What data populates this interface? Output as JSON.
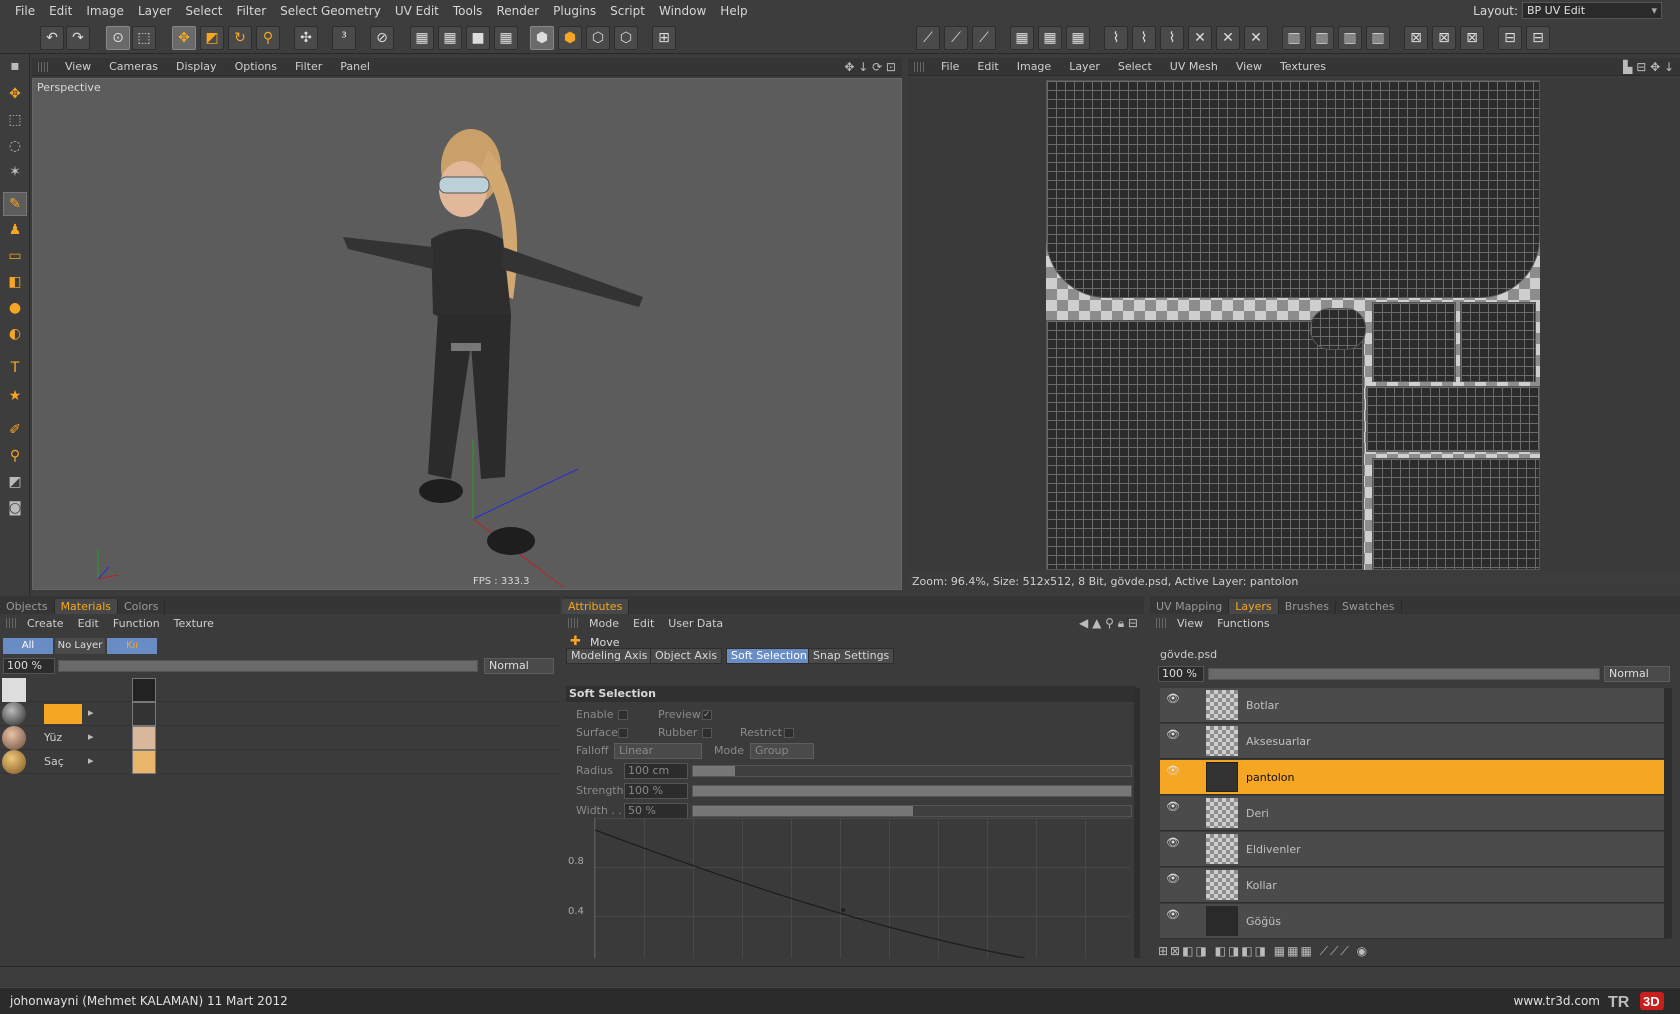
{
  "menu": [
    "File",
    "Edit",
    "Image",
    "Layer",
    "Select",
    "Filter",
    "Select Geometry",
    "UV Edit",
    "Tools",
    "Render",
    "Plugins",
    "Script",
    "Window",
    "Help"
  ],
  "layout": {
    "label": "Layout:",
    "value": "BP UV Edit"
  },
  "viewport3d": {
    "menu": [
      "View",
      "Cameras",
      "Display",
      "Options",
      "Filter",
      "Panel"
    ],
    "name": "Perspective",
    "fps": "FPS : 333.3"
  },
  "uvpanel": {
    "menu": [
      "File",
      "Edit",
      "Image",
      "Layer",
      "Select",
      "UV Mesh",
      "View",
      "Textures"
    ],
    "status": "Zoom: 96.4%, Size: 512x512, 8 Bit, gövde.psd, Active Layer: pantolon"
  },
  "leftpanel": {
    "tabs": [
      "Objects",
      "Materials",
      "Colors"
    ],
    "menu": [
      "Create",
      "Edit",
      "Function",
      "Texture"
    ],
    "filters": [
      "All",
      "No Layer",
      "Kıı"
    ],
    "zoom": "100 %",
    "blend": "Normal",
    "materials": [
      "",
      "Yüz",
      "Saç"
    ]
  },
  "attributes": {
    "tab": "Attributes",
    "menu": [
      "Mode",
      "Edit",
      "User Data"
    ],
    "tool": "Move",
    "subtabs": [
      "Modeling Axis",
      "Object Axis",
      "Soft Selection",
      "Snap Settings"
    ],
    "section": "Soft Selection",
    "labels": {
      "enable": "Enable",
      "preview": "Preview",
      "surface": "Surface",
      "rubber": "Rubber",
      "restrict": "Restrict",
      "falloff": "Falloff",
      "falloff_val": "Linear",
      "mode": "Mode",
      "mode_val": "Group",
      "radius": "Radius",
      "radius_val": "100 cm",
      "strength": "Strength",
      "strength_val": "100 %",
      "width": "Width . .",
      "width_val": "50 %"
    },
    "graph_labels": [
      "0.8",
      "0.4"
    ]
  },
  "rightpanel": {
    "tabs": [
      "UV Mapping",
      "Layers",
      "Brushes",
      "Swatches"
    ],
    "menu": [
      "View",
      "Functions"
    ],
    "file": "gövde.psd",
    "zoom": "100 %",
    "blend": "Normal",
    "layers": [
      "Botlar",
      "Aksesuarlar",
      "pantolon",
      "Deri",
      "Eldivenler",
      "Kollar",
      "Göğüs"
    ],
    "active_layer": "pantolon"
  },
  "footer": {
    "credit": "johonwayni (Mehmet KALAMAN)  11 Mart 2012",
    "site": "www.tr3d.com",
    "logo": "TR3D"
  },
  "colors": {
    "accent": "#f5a623",
    "selection": "#6a8cc4",
    "panel": "#3b3b3b"
  }
}
